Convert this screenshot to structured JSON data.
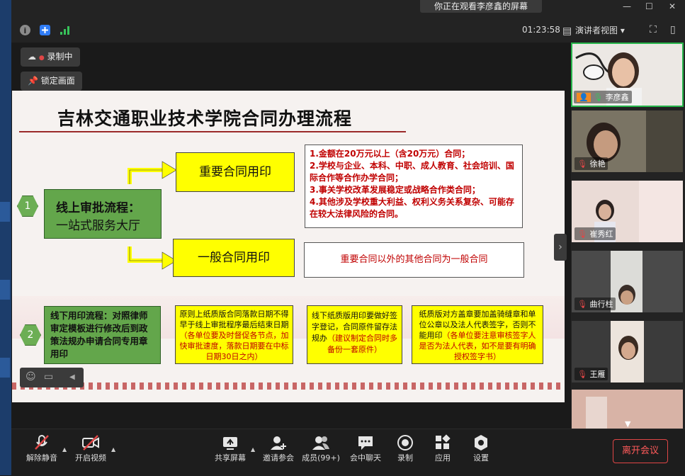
{
  "topbar": {
    "viewing_notice": "你正在观看李彦鑫的屏幕",
    "minimize": "—",
    "restore": "☐",
    "close": "✕",
    "timer": "01:23:58",
    "view_mode": "演讲者视图",
    "view_caret": "▾"
  },
  "share": {
    "recording_label": "录制中",
    "lock_label": "锁定画面"
  },
  "slide": {
    "title": "吉林交通职业技术学院合同办理流程",
    "step1_num": "1",
    "step1_line1": "线上审批流程：",
    "step1_line2": "一站式服务大厅",
    "important_label": "重要合同用印",
    "general_label": "一般合同用印",
    "important_rules": [
      "1.金额在20万元以上（含20万元）合同；",
      "2.学校与企业、本科、中职、成人教育、社会培训、国际合作等合作办学合同；",
      "3.事关学校改革发展稳定或战略合作类合同；",
      "4.其他涉及学校重大利益、权利义务关系复杂、可能存在较大法律风险的合同。"
    ],
    "general_rule": "重要合同以外的其他合同为一般合同",
    "step2_num": "2",
    "step2_text": "线下用印流程：对照律师审定模板进行修改后到政策法规办申请合同专用章用印",
    "box_a_black": "原则上纸质版合同落款日期不得早于线上审批程序最后结束日期",
    "box_a_red": "（各单位要及时督促各节点，加快审批速度，落款日期要在中标日期30日之内）",
    "box_b_black": "线下纸质版用印要做好签字登记，合同原件留存法规办",
    "box_b_red": "（建议制定合同时多备份一套原件）",
    "box_c_black": "纸质版对方盖章要加盖骑缝章和单位公章以及法人代表签字，否则不能用印",
    "box_c_red": "（各单位要注意审核签字人是否为法人代表，如不是要有明确授权签字书）"
  },
  "participants": [
    {
      "name": "李彦鑫"
    },
    {
      "name": "徐艳"
    },
    {
      "name": "崔秀红"
    },
    {
      "name": "曲行柱"
    },
    {
      "name": "王雁"
    }
  ],
  "toolbar": {
    "unmute": "解除静音",
    "start_video": "开启视频",
    "share_screen": "共享屏幕",
    "invite": "邀请参会",
    "members": "成员(99+)",
    "chat": "会中聊天",
    "record": "录制",
    "apps": "应用",
    "settings": "设置",
    "leave": "离开会议"
  },
  "colors": {
    "accent_green": "#27b54b",
    "leave_red": "#e04646",
    "slide_yellow": "#ffff00",
    "slide_green": "#63a64b",
    "rule_red": "#c00000"
  }
}
